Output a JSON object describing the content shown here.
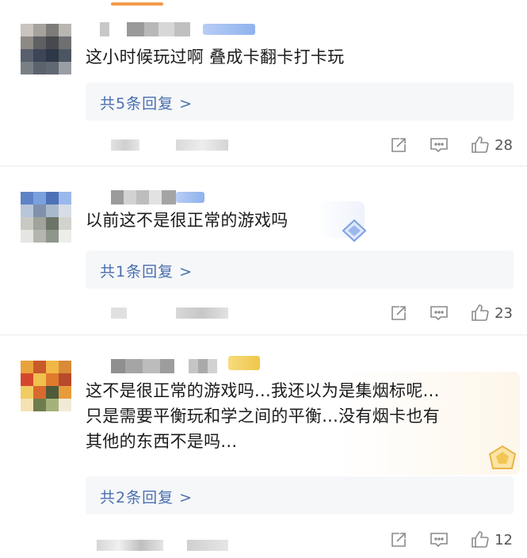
{
  "comments": [
    {
      "text": "这小时候玩过啊 叠成卡翻卡打卡玩",
      "reply_link": "共5条回复 >",
      "likes": "28",
      "icons": [
        "share-icon",
        "comment-icon",
        "thumbs-up-icon"
      ]
    },
    {
      "text": "以前这不是很正常的游戏吗",
      "reply_link": "共1条回复 >",
      "likes": "23",
      "icons": [
        "share-icon",
        "comment-icon",
        "thumbs-up-icon"
      ]
    },
    {
      "text": "这不是很正常的游戏吗...我还以为是集烟标呢...\n只是需要平衡玩和学之间的平衡...没有烟卡也有\n其他的东西不是吗...",
      "reply_link": "共2条回复 >",
      "likes": "12",
      "icons": [
        "share-icon",
        "comment-icon",
        "thumbs-up-icon"
      ]
    }
  ],
  "colors": {
    "reply_link": "#4a6fb0",
    "action_icon": "#8a8a8a",
    "reply_bg": "#f6f7f9",
    "vip_blue": "#8fb2ee",
    "vip_gold": "#f0c64a"
  }
}
